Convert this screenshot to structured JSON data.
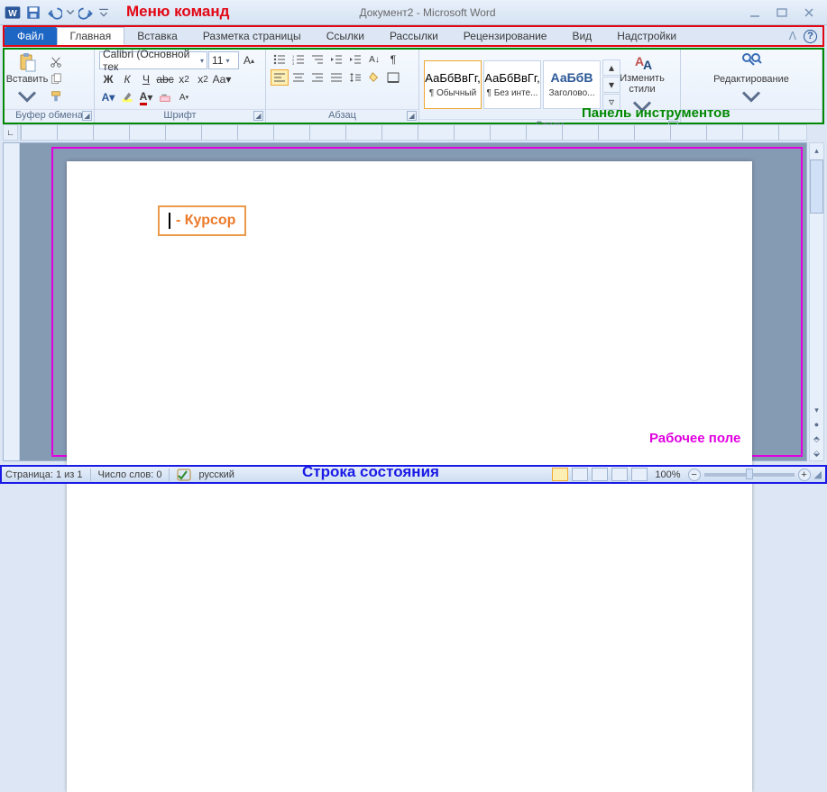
{
  "title": "Документ2 - Microsoft Word",
  "annotations": {
    "menu": "Меню команд",
    "tools": "Панель инструментов",
    "workspace": "Рабочее поле",
    "statusbar": "Строка состояния",
    "cursor": "- Курсор"
  },
  "tabs": {
    "file": "Файл",
    "home": "Главная",
    "insert": "Вставка",
    "layout": "Разметка страницы",
    "references": "Ссылки",
    "mailings": "Рассылки",
    "review": "Рецензирование",
    "view": "Вид",
    "addins": "Надстройки"
  },
  "ribbon": {
    "clipboard": {
      "label": "Буфер обмена",
      "paste": "Вставить"
    },
    "font": {
      "label": "Шрифт",
      "name": "Calibri (Основной тек",
      "size": "11"
    },
    "paragraph": {
      "label": "Абзац"
    },
    "styles": {
      "label": "Стили",
      "change": "Изменить стили",
      "sample": "АаБбВвГг,",
      "sample_heading": "АаБбВ",
      "normal": "¶ Обычный",
      "nospacing": "¶ Без инте...",
      "heading1": "Заголово..."
    },
    "editing": {
      "label": "Редактирование"
    }
  },
  "ruler_corner": "∟",
  "status": {
    "page": "Страница: 1 из 1",
    "words": "Число слов: 0",
    "language": "русский",
    "zoom": "100%"
  }
}
